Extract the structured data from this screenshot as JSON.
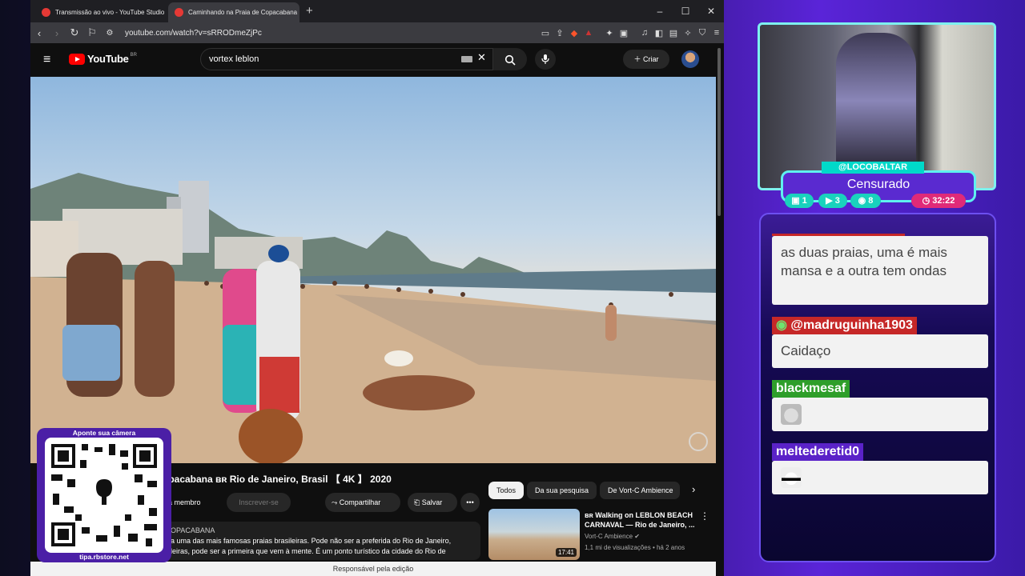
{
  "browser": {
    "tabs": [
      {
        "title": "Transmissão ao vivo - YouTube Studio"
      },
      {
        "title": "Caminhando na Praia de Copacabana"
      }
    ],
    "new_tab": "+",
    "url": "youtube.com/watch?v=sRRODmeZjPc"
  },
  "youtube": {
    "logo": "YouTube",
    "region": "BR",
    "search_value": "vortex leblon",
    "create_label": "Criar",
    "video_title": "opacabana ʙʀ Rio de Janeiro, Brasil 【 4K 】 2020",
    "buttons": {
      "join": "eja membro",
      "subscribe": "Inscrever-se",
      "share": "Compartilhar",
      "save": "Salvar"
    },
    "description": {
      "channel": "OPACABANA",
      "line1": "a uma das mais famosas praias brasileiras. Pode não ser a preferida do Rio de Janeiro,",
      "line2": "leiras, pode ser a primeira que vem à mente. É um ponto turístico da cidade do Rio de"
    },
    "chips": [
      "Todos",
      "Da sua pesquisa",
      "De Vort-C Ambience"
    ],
    "recommendation": {
      "title": "ʙʀ Walking on LEBLON BEACH CARNAVAL — Rio de Janeiro, ...",
      "channel": "Vort-C Ambience",
      "views": "1,1 mi de visualizações",
      "age": "há 2 anos",
      "duration": "17:41"
    },
    "footer": "Responsável pela edição"
  },
  "overlay": {
    "qr_top": "Aponte sua câmera",
    "qr_bottom": "tipa.rbstore.net"
  },
  "stream": {
    "handle": "@LOCOBALTAR",
    "status": "Censurado",
    "stats": {
      "twitch": "1",
      "youtube": "3",
      "kick": "8",
      "time": "32:22"
    }
  },
  "chat": [
    {
      "user": "",
      "text": "as duas praias, uma é mais mansa e a outra tem ondas"
    },
    {
      "user": "@madruguinha1903",
      "text": "Caidaço"
    },
    {
      "user": "blackmesaf",
      "text": ""
    },
    {
      "user": "meltederetid0",
      "text": ""
    }
  ],
  "colors": {
    "yt_red": "#ff0000",
    "overlay_purple": "#4b1fa6",
    "accent_cyan": "#5ff0ef",
    "name_red": "#c62828",
    "name_green": "#2e9e2a",
    "name_purple": "#5a22c8"
  }
}
